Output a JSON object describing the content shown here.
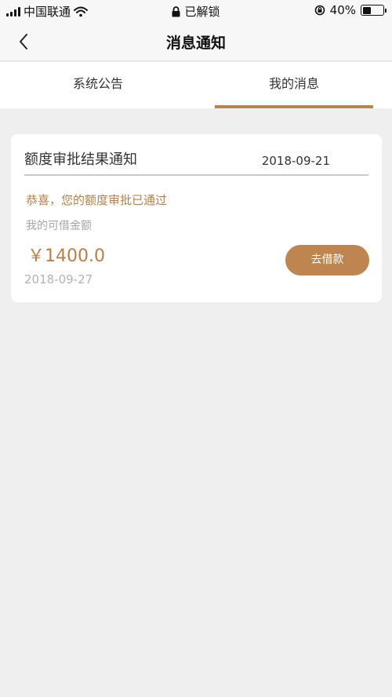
{
  "status_bar": {
    "carrier": "中国联通",
    "lock_text": "已解锁",
    "battery": "40%"
  },
  "nav": {
    "title": "消息通知"
  },
  "tabs": [
    {
      "label": "系统公告",
      "active": false
    },
    {
      "label": "我的消息",
      "active": true
    }
  ],
  "message": {
    "title": "额度审批结果通知",
    "date": "2018-09-21",
    "content": "恭喜，您的额度审批已通过",
    "amount_label": "我的可借金额",
    "amount": "￥1400.0",
    "amount_date": "2018-09-27",
    "action_label": "去借款"
  },
  "colors": {
    "accent": "#b88550",
    "background": "#efefef"
  }
}
